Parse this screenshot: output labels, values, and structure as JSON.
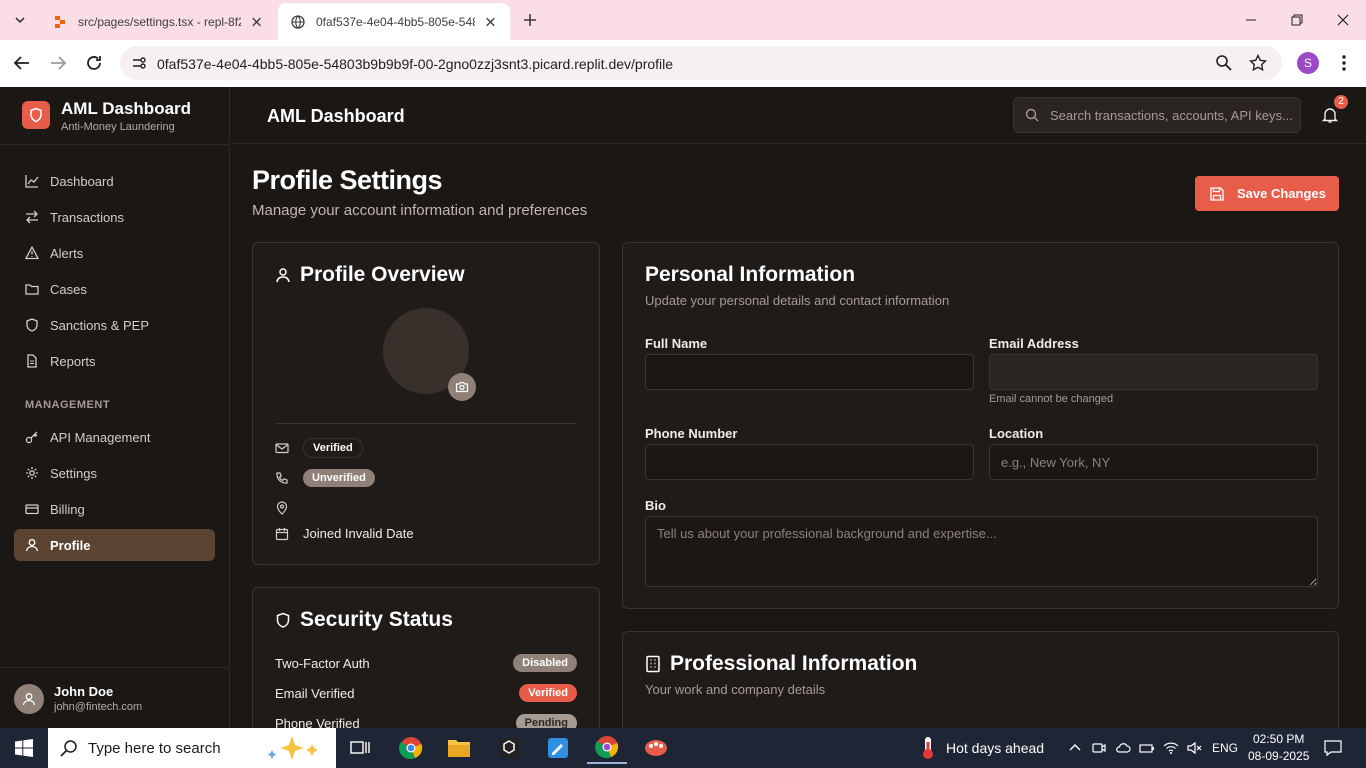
{
  "browser": {
    "tabs": [
      {
        "title": "src/pages/settings.tsx - repl-8f2..."
      },
      {
        "title": "0faf537e-4e04-4bb5-805e-5480..."
      }
    ],
    "url": "0faf537e-4e04-4bb5-805e-54803b9b9b9f-00-2gno0zzj3snt3.picard.replit.dev/profile",
    "profile_initial": "S"
  },
  "sidebar": {
    "brand_title": "AML Dashboard",
    "brand_subtitle": "Anti-Money Laundering",
    "nav": [
      {
        "label": "Dashboard",
        "icon": "chart-line-icon"
      },
      {
        "label": "Transactions",
        "icon": "arrows-exchange-icon"
      },
      {
        "label": "Alerts",
        "icon": "alert-triangle-icon"
      },
      {
        "label": "Cases",
        "icon": "folder-icon"
      },
      {
        "label": "Sanctions & PEP",
        "icon": "shield-icon"
      },
      {
        "label": "Reports",
        "icon": "file-text-icon"
      }
    ],
    "management_label": "MANAGEMENT",
    "management": [
      {
        "label": "API Management",
        "icon": "key-icon"
      },
      {
        "label": "Settings",
        "icon": "gear-icon"
      },
      {
        "label": "Billing",
        "icon": "credit-card-icon"
      },
      {
        "label": "Profile",
        "icon": "user-icon",
        "active": true
      }
    ],
    "user": {
      "name": "John Doe",
      "email": "john@fintech.com"
    }
  },
  "header": {
    "title": "AML Dashboard",
    "search_placeholder": "Search transactions, accounts, API keys...",
    "notification_count": "2"
  },
  "page": {
    "title": "Profile Settings",
    "subtitle": "Manage your account information and preferences",
    "save_label": "Save Changes"
  },
  "overview": {
    "title": "Profile Overview",
    "email_status": "Verified",
    "phone_status": "Unverified",
    "joined": "Joined Invalid Date"
  },
  "security": {
    "title": "Security Status",
    "rows": [
      {
        "label": "Two-Factor Auth",
        "status": "Disabled"
      },
      {
        "label": "Email Verified",
        "status": "Verified"
      },
      {
        "label": "Phone Verified",
        "status": "Pending"
      }
    ]
  },
  "personal": {
    "title": "Personal Information",
    "subtitle": "Update your personal details and contact information",
    "full_name_label": "Full Name",
    "full_name_value": "",
    "email_label": "Email Address",
    "email_value": "",
    "email_hint": "Email cannot be changed",
    "phone_label": "Phone Number",
    "phone_value": "",
    "location_label": "Location",
    "location_placeholder": "e.g., New York, NY",
    "bio_label": "Bio",
    "bio_placeholder": "Tell us about your professional background and expertise..."
  },
  "professional": {
    "title": "Professional Information",
    "subtitle": "Your work and company details"
  },
  "taskbar": {
    "search_placeholder": "Type here to search",
    "weather": "Hot days ahead",
    "lang": "ENG",
    "time": "02:50 PM",
    "date": "08-09-2025"
  },
  "colors": {
    "accent": "#e85d4a",
    "active_nav": "#5c4433",
    "background": "#1a1715"
  }
}
